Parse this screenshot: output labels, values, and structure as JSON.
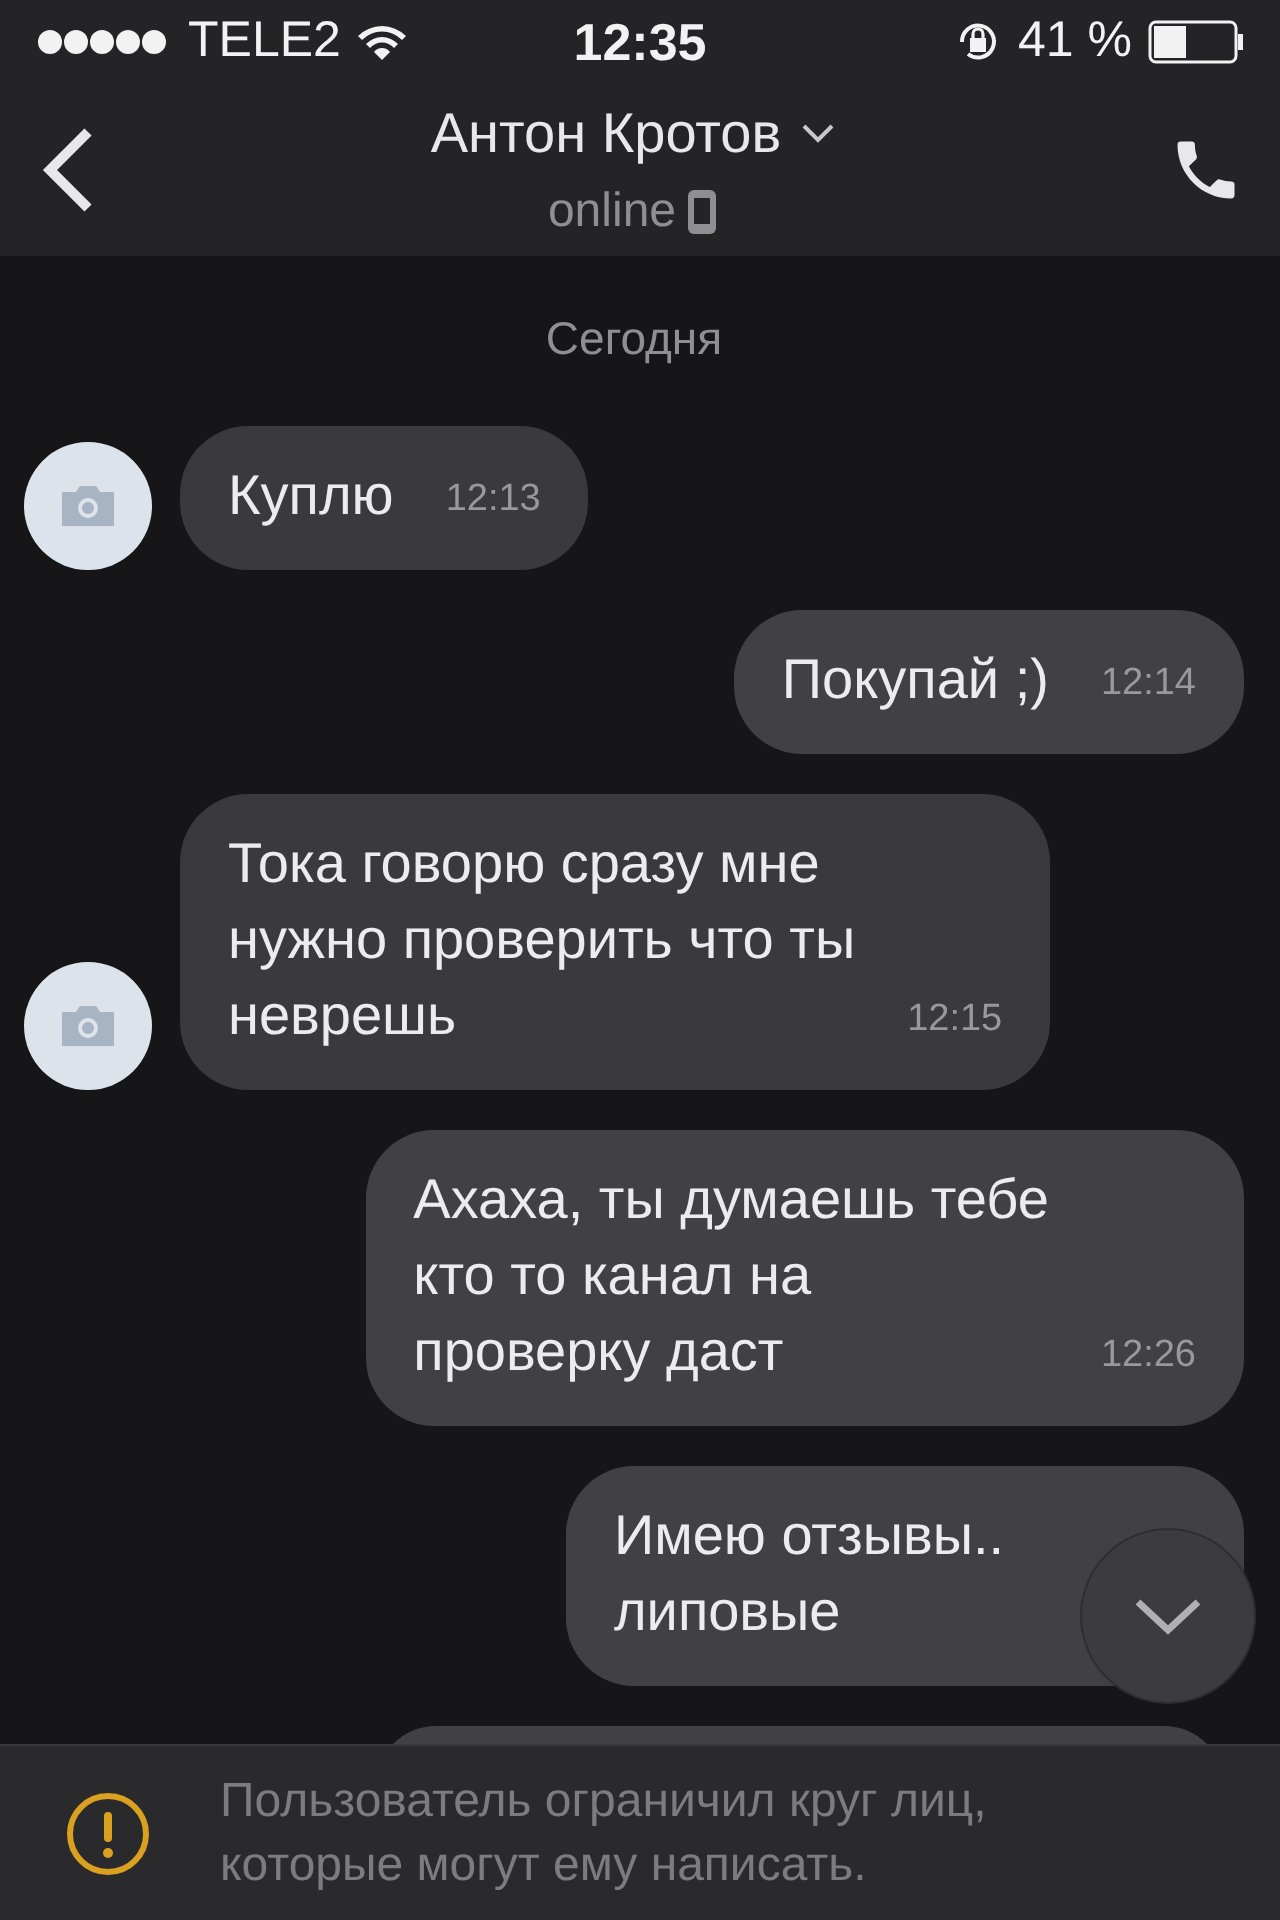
{
  "status_bar": {
    "carrier": "TELE2",
    "time": "12:35",
    "battery": "41 %",
    "level": 0.41
  },
  "header": {
    "name": "Антон Кротов",
    "status": "online"
  },
  "date_label": "Сегодня",
  "messages": [
    {
      "kind": "incoming",
      "text": "Куплю",
      "time": "12:13"
    },
    {
      "kind": "outgoing",
      "text": "Покупай ;)",
      "time": "12:14"
    },
    {
      "kind": "incoming",
      "text": "Тока говорю сразу мне\nнужно проверить что ты\nневрешь",
      "time": "12:15"
    },
    {
      "kind": "outgoing",
      "text": "Ахаха, ты думаешь тебе\nкто то канал на\nпроверку даст",
      "time": "12:26"
    },
    {
      "kind": "outgoing",
      "text": "Имею отзывы..\nлиповые"
    },
    {
      "kind": "outgoing"
    }
  ],
  "notice": {
    "text": "Пользователь ограничил круг лиц,\nкоторые могут ему написать."
  }
}
